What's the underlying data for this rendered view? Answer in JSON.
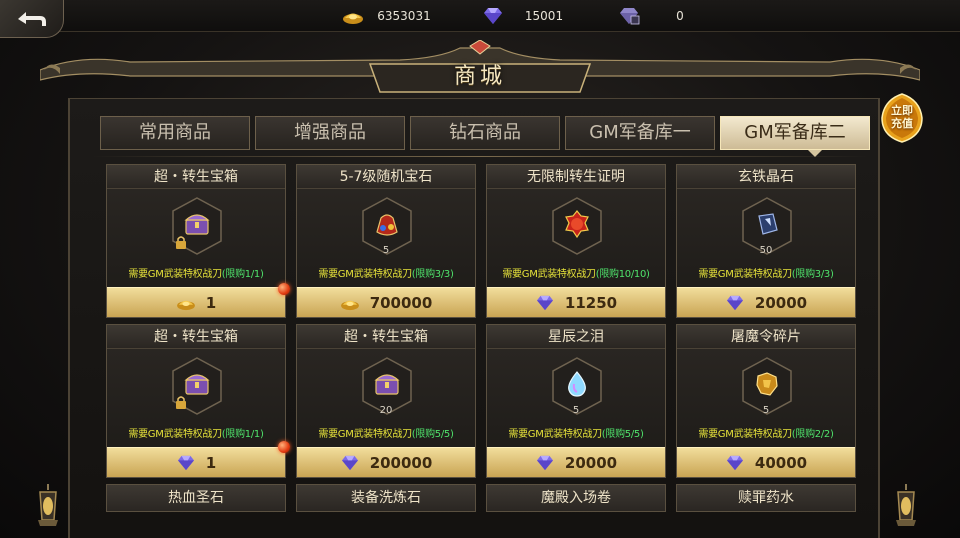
{
  "currencies": {
    "gold": "6353031",
    "diamond": "15001",
    "bound_diamond": "0"
  },
  "title": "商城",
  "recharge_label": "立即充值",
  "tabs": [
    {
      "label": "常用商品",
      "active": false
    },
    {
      "label": "增强商品",
      "active": false
    },
    {
      "label": "钻石商品",
      "active": false
    },
    {
      "label": "GM军备库一",
      "active": false
    },
    {
      "label": "GM军备库二",
      "active": true
    }
  ],
  "items": [
    {
      "name": "超・转生宝箱",
      "icon": "treasure-chest-icon",
      "qty": "",
      "req": "需要GM武装特权战刀",
      "limit": "(限购1/1)",
      "currency": "gold",
      "price": "1",
      "red_dot": true
    },
    {
      "name": "5-7级随机宝石",
      "icon": "gem-bag-icon",
      "qty": "5",
      "req": "需要GM武装特权战刀",
      "limit": "(限购3/3)",
      "currency": "gold",
      "price": "700000",
      "red_dot": false
    },
    {
      "name": "无限制转生证明",
      "icon": "unlimited-badge-icon",
      "qty": "",
      "req": "需要GM武装特权战刀",
      "limit": "(限购10/10)",
      "currency": "diamond",
      "price": "11250",
      "red_dot": false
    },
    {
      "name": "玄铁晶石",
      "icon": "crystal-ore-icon",
      "qty": "50",
      "req": "需要GM武装特权战刀",
      "limit": "(限购3/3)",
      "currency": "diamond",
      "price": "20000",
      "red_dot": false
    },
    {
      "name": "超・转生宝箱",
      "icon": "treasure-chest-icon",
      "qty": "",
      "req": "需要GM武装特权战刀",
      "limit": "(限购1/1)",
      "currency": "diamond",
      "price": "1",
      "red_dot": true
    },
    {
      "name": "超・转生宝箱",
      "icon": "treasure-chest-icon",
      "qty": "20",
      "req": "需要GM武装特权战刀",
      "limit": "(限购5/5)",
      "currency": "diamond",
      "price": "200000",
      "red_dot": false
    },
    {
      "name": "星辰之泪",
      "icon": "teardrop-icon",
      "qty": "5",
      "req": "需要GM武装特权战刀",
      "limit": "(限购5/5)",
      "currency": "diamond",
      "price": "20000",
      "red_dot": false
    },
    {
      "name": "屠魔令碎片",
      "icon": "token-fragment-icon",
      "qty": "5",
      "req": "需要GM武装特权战刀",
      "limit": "(限购2/2)",
      "currency": "diamond",
      "price": "40000",
      "red_dot": false
    }
  ],
  "partial_items": [
    {
      "name": "热血圣石"
    },
    {
      "name": "装备洗炼石"
    },
    {
      "name": "魔殿入场卷"
    },
    {
      "name": "赎罪药水"
    }
  ],
  "colors": {
    "accent_gold": "#c9a453",
    "requirement_yellow": "#e5e23a",
    "limit_green": "#4fe36b",
    "tab_active": "#f3e9cf"
  }
}
